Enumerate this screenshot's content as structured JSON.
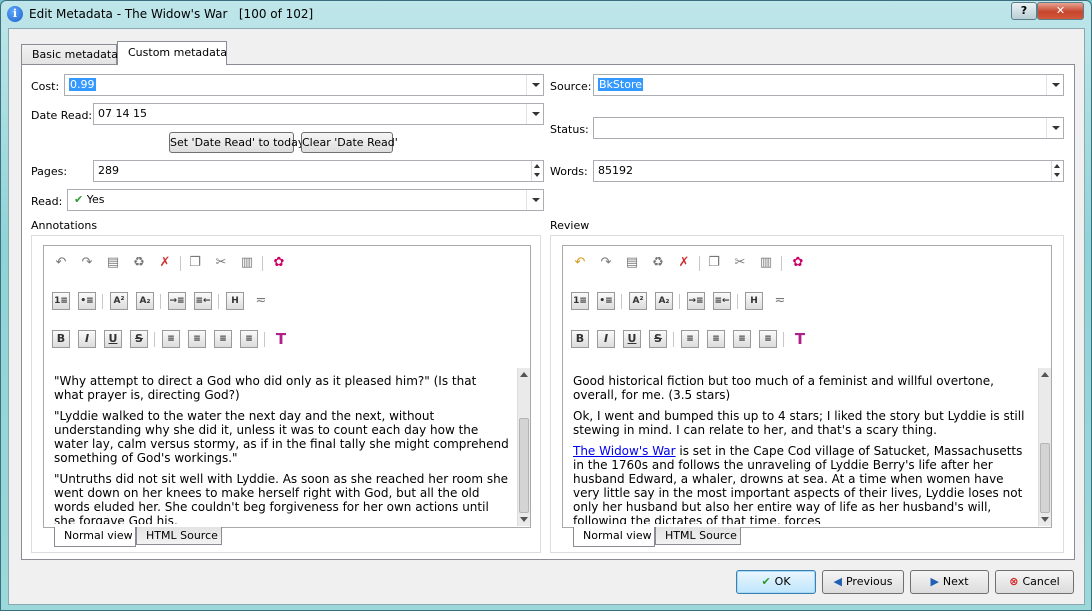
{
  "window": {
    "title": "Edit Metadata - The Widow's War   [100 of 102]",
    "help_label": "?",
    "close_label": "✕"
  },
  "tabs": [
    "Basic metadata",
    "Custom metadata"
  ],
  "fields": {
    "cost": {
      "label": "Cost:",
      "value": "0.99"
    },
    "date_read": {
      "label": "Date Read:",
      "value": "07 14 15"
    },
    "set_date_btn": "Set 'Date Read' to today",
    "clear_date_btn": "Clear 'Date Read'",
    "pages": {
      "label": "Pages:",
      "value": "289"
    },
    "read": {
      "label": "Read:",
      "value": "Yes"
    },
    "source": {
      "label": "Source:",
      "value": "BkStore"
    },
    "status": {
      "label": "Status:",
      "value": ""
    },
    "words": {
      "label": "Words:",
      "value": "85192"
    }
  },
  "annotations": {
    "label": "Annotations",
    "paragraphs": [
      "\"Why attempt to direct a God who did only as it pleased him?\" (Is that what prayer is, directing God?)",
      "\"Lyddie walked to the water the next day and the next, without understanding why she did it, unless it was to count each day how the water lay, calm versus stormy, as if in the final tally she might comprehend something of God's workings.\"",
      "\"Untruths did not sit well with Lyddie. As soon as she reached her room she went down on her knees to make herself right with God, but all the old words eluded her. She couldn't beg forgiveness for her own actions until she forgave God his,"
    ]
  },
  "review": {
    "label": "Review",
    "p1": "Good historical fiction but too much of a feminist and willful overtone, overall, for me. (3.5 stars)",
    "p2": "Ok, I went and bumped this up to 4 stars; I liked the story but Lyddie is still stewing in mind. I can relate to her, and that's a scary thing.",
    "p3_link": "The Widow's War",
    "p3_rest": " is set in the Cape Cod village of Satucket, Massachusetts in the 1760s and follows the unraveling of Lyddie Berry's life after her husband Edward, a whaler, drowns at sea. At a time when women have very little say in the most important aspects of their lives, Lyddie loses not only her husband but also her entire way of life as her husband's will, following the dictates of that time, forces"
  },
  "editor_tabs": [
    "Normal view",
    "HTML Source"
  ],
  "buttons": {
    "ok": "OK",
    "previous": "Previous",
    "next": "Next",
    "cancel": "Cancel"
  },
  "colors": {
    "ok_icon": "#2e9b2e",
    "nav_icon": "#1f5fb4",
    "cancel_icon": "#d32020",
    "selection": "#3399ff"
  }
}
